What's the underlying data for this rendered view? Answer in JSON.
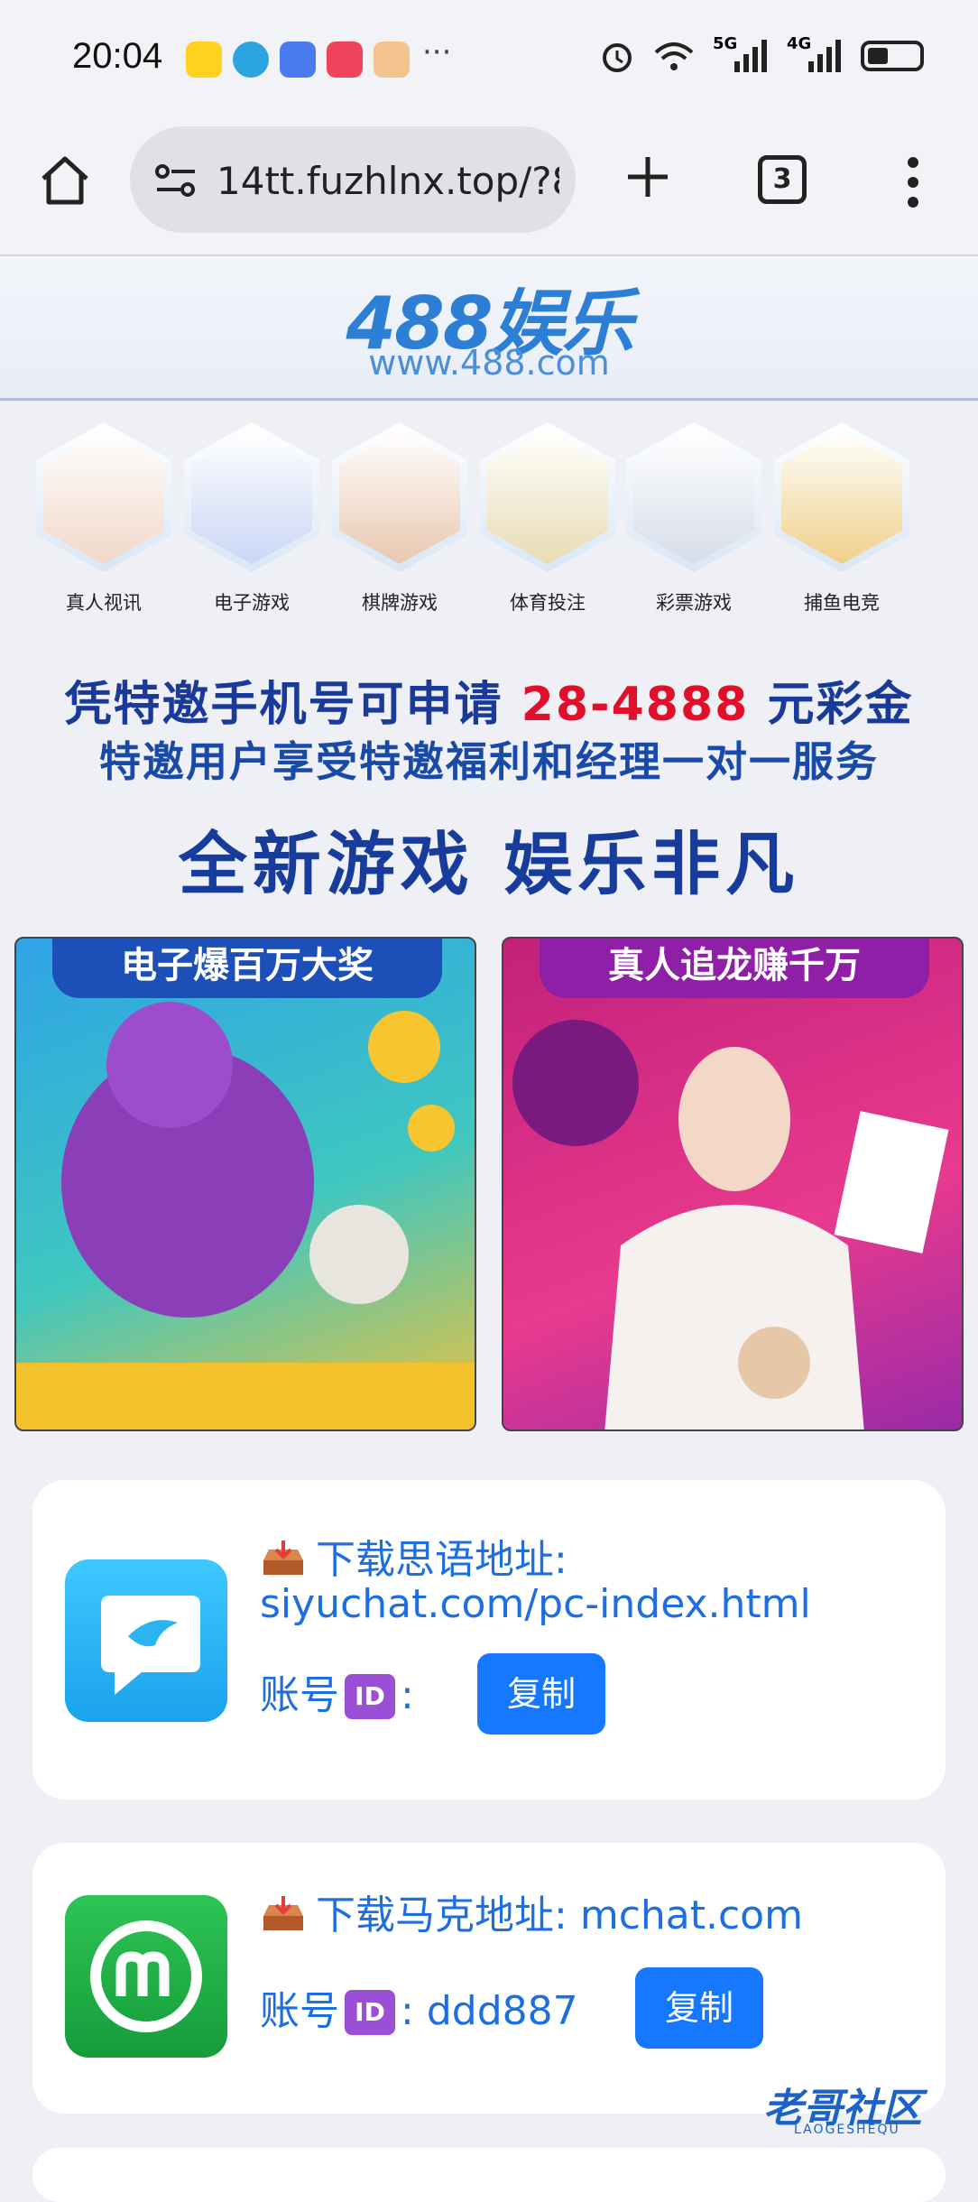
{
  "status_bar": {
    "time": "20:04",
    "notification_icons": [
      "xianyu-app-icon",
      "telegram-icon",
      "messages-icon",
      "video-app-icon",
      "mascot-app-icon"
    ],
    "more": "···",
    "signal1": "5G",
    "signal2": "4G",
    "battery_level": 0.4
  },
  "browser": {
    "url": "14tt.fuzhlnx.top/?8",
    "tab_count": "3"
  },
  "site": {
    "logo": "488娱乐",
    "logo_url": "www.488.com",
    "categories": [
      {
        "label": "真人视讯",
        "icon": "live-dealer-icon"
      },
      {
        "label": "电子游戏",
        "icon": "slot-wizard-icon"
      },
      {
        "label": "棋牌游戏",
        "icon": "playing-cards-icon"
      },
      {
        "label": "体育投注",
        "icon": "sports-player-icon"
      },
      {
        "label": "彩票游戏",
        "icon": "lottery-icon"
      },
      {
        "label": "捕鱼电竞",
        "icon": "fish-game-icon"
      }
    ],
    "promo_line1_a": "凭特邀手机号可申请",
    "promo_line1_highlight": "28-4888",
    "promo_line1_b": "元彩金",
    "promo_line2": "特邀用户享受特邀福利和经理一对一服务",
    "promo_line3": "全新游戏 娱乐非凡",
    "banners": [
      {
        "title": "电子爆百万大奖"
      },
      {
        "title": "真人追龙赚千万"
      }
    ]
  },
  "downloads": [
    {
      "label": "下载思语地址:",
      "url": "siyuchat.com/pc-index.html",
      "account_label": "账号",
      "id_badge": "ID",
      "colon": ":",
      "account_value": "",
      "copy_label": "复制",
      "app_color": "#2fb6f5"
    },
    {
      "label": "下载马克地址:",
      "url": "mchat.com",
      "account_label": "账号",
      "id_badge": "ID",
      "colon": ":",
      "account_value": "ddd887",
      "copy_label": "复制",
      "app_color": "#22b04a"
    }
  ],
  "watermark": {
    "text": "老哥社区",
    "sub": "LAOGESHEQU"
  }
}
